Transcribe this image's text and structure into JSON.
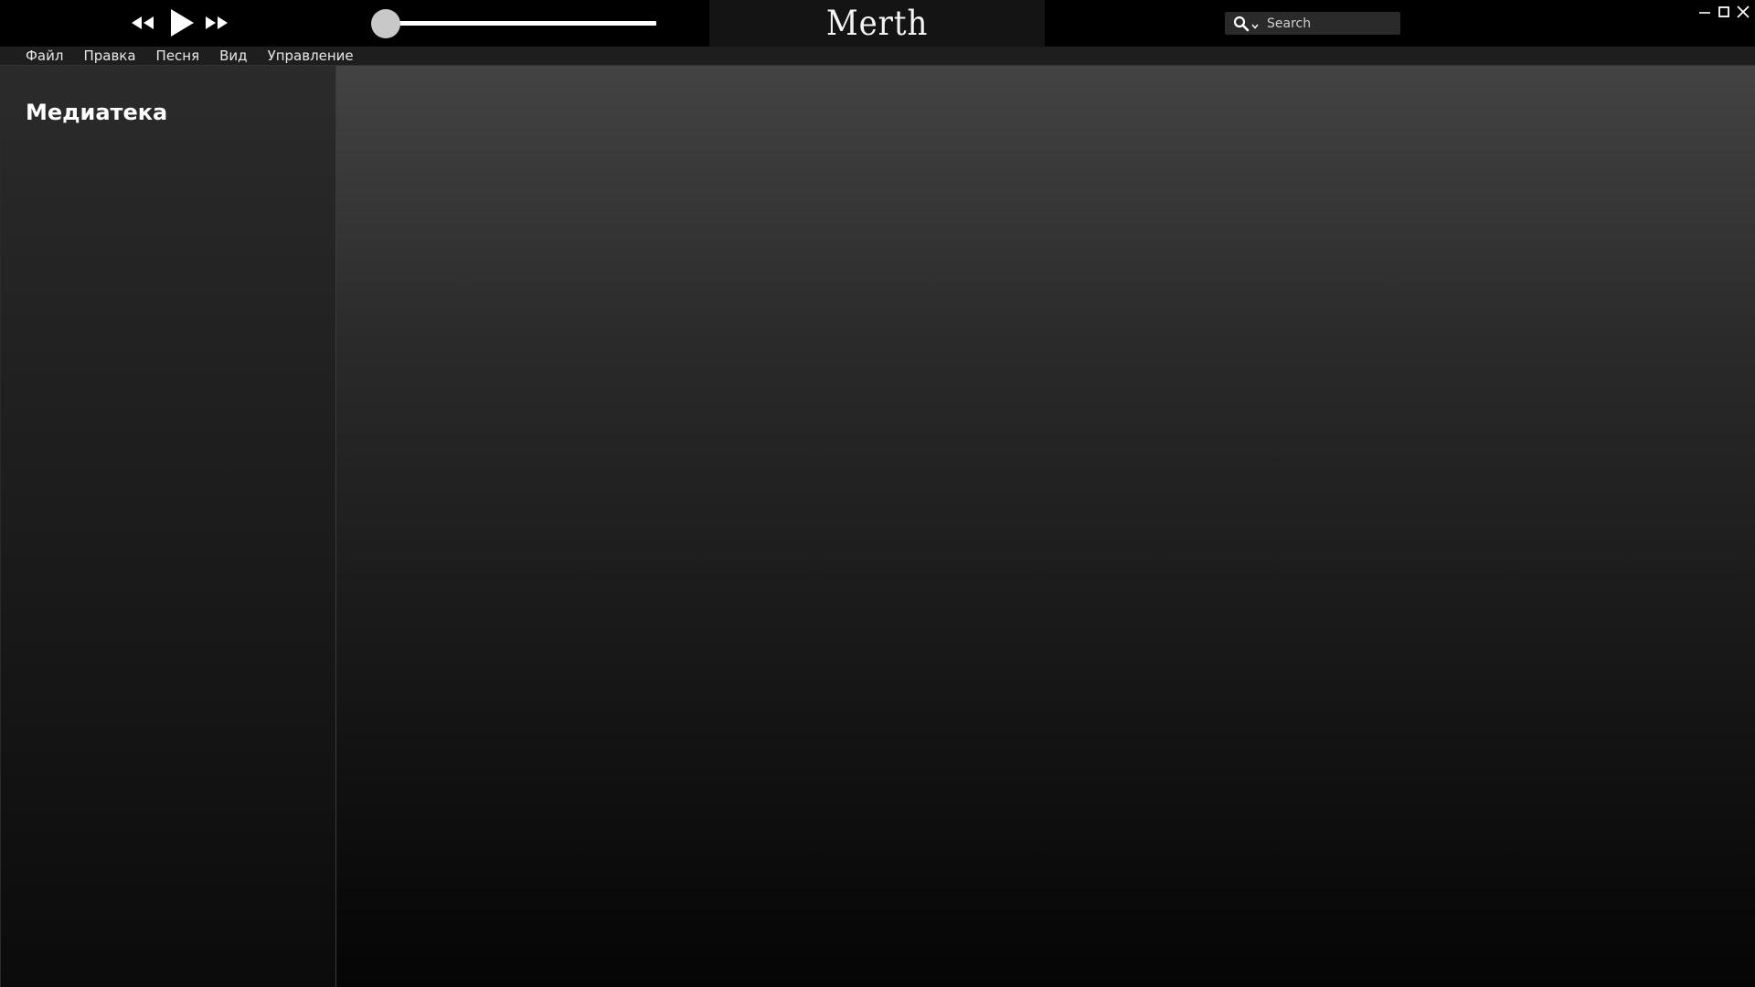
{
  "app": {
    "logo_text": "Merth"
  },
  "transport": {
    "progress_fraction": 0.0
  },
  "search": {
    "placeholder": "Search",
    "value": ""
  },
  "window_controls": {
    "minimize_icon": "minimize-icon",
    "maximize_icon": "maximize-icon",
    "close_icon": "close-icon"
  },
  "menu": {
    "items": [
      "Файл",
      "Правка",
      "Песня",
      "Вид",
      "Управление"
    ]
  },
  "sidebar": {
    "heading": "Медиатека"
  }
}
